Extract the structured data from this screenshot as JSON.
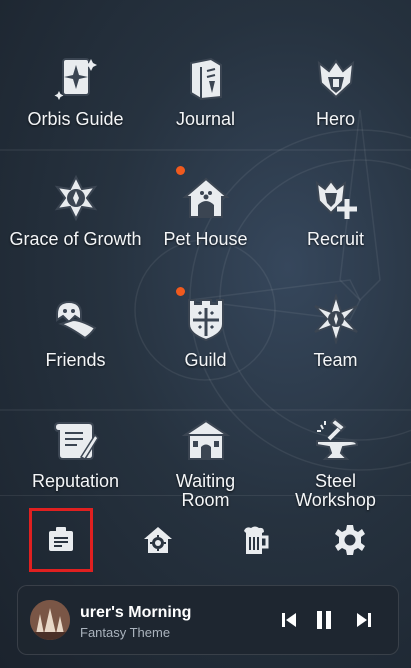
{
  "menu": {
    "items": [
      {
        "label": "Orbis Guide",
        "icon": "orbis-guide-icon"
      },
      {
        "label": "Journal",
        "icon": "journal-icon"
      },
      {
        "label": "Hero",
        "icon": "hero-icon"
      },
      {
        "label": "Grace of Growth",
        "icon": "grace-of-growth-icon"
      },
      {
        "label": "Pet House",
        "icon": "pet-house-icon",
        "notification": true
      },
      {
        "label": "Recruit",
        "icon": "recruit-icon"
      },
      {
        "label": "Friends",
        "icon": "friends-icon"
      },
      {
        "label": "Guild",
        "icon": "guild-icon",
        "notification": true
      },
      {
        "label": "Team",
        "icon": "team-icon"
      },
      {
        "label": "Reputation",
        "icon": "reputation-icon"
      },
      {
        "label": "Waiting\nRoom",
        "icon": "waiting-room-icon"
      },
      {
        "label": "Steel\nWorkshop",
        "icon": "steel-workshop-icon"
      }
    ]
  },
  "toolbar": {
    "buttons": [
      {
        "icon": "notice-board-icon",
        "selected": true
      },
      {
        "icon": "house-settings-icon"
      },
      {
        "icon": "beer-mug-icon"
      },
      {
        "icon": "gear-icon"
      }
    ]
  },
  "player": {
    "title": "urer's Morning",
    "subtitle": "Fantasy Theme",
    "controls": [
      "previous-icon",
      "pause-icon",
      "next-icon"
    ]
  },
  "colors": {
    "notification_dot": "#f05a1e",
    "selection_outline": "#e02020",
    "background": "#26323f"
  }
}
